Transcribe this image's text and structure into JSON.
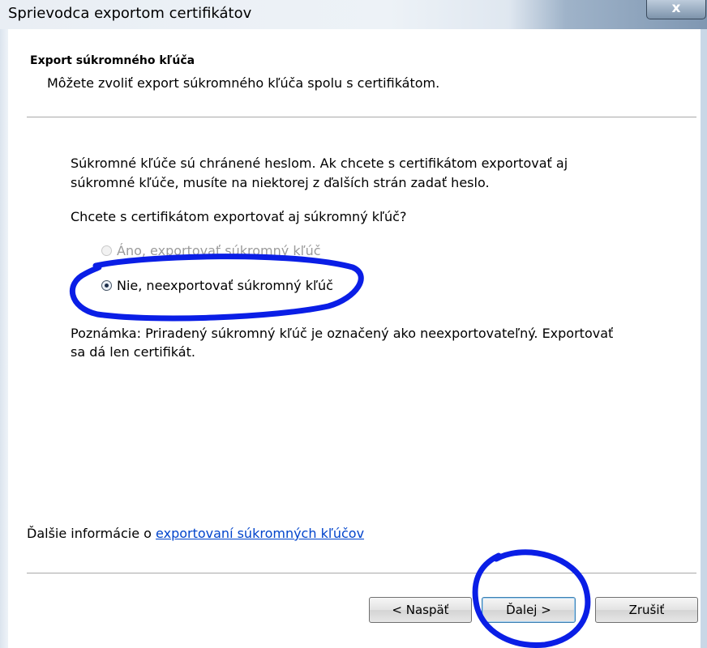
{
  "window": {
    "title": "Sprievodca exportom certifikátov",
    "close_label": "x"
  },
  "header": {
    "title": "Export súkromného kľúča",
    "subtitle": "Môžete zvoliť export súkromného kľúča spolu s certifikátom."
  },
  "body": {
    "info_line1": "Súkromné kľúče sú chránené heslom. Ak chcete s certifikátom exportovať aj",
    "info_line2": "súkromné kľúče, musíte na niektorej z ďalších strán zadať heslo.",
    "question": "Chcete s certifikátom exportovať aj súkromný kľúč?",
    "options": [
      {
        "label": "Áno, exportovať súkromný kľúč",
        "enabled": false,
        "selected": false
      },
      {
        "label": "Nie, neexportovať súkromný kľúč",
        "enabled": true,
        "selected": true
      }
    ],
    "note_line1": "Poznámka: Priradený súkromný kľúč je označený ako neexportovateľný. Exportovať",
    "note_line2": "sa dá len certifikát."
  },
  "footer": {
    "more_info_prefix": "Ďalšie informácie o ",
    "more_info_link": "exportovaní súkromných kľúčov"
  },
  "buttons": {
    "back": "< Naspäť",
    "next": "Ďalej >",
    "cancel": "Zrušiť"
  },
  "colors": {
    "annotation": "#0a1ee6",
    "link": "#0044cc"
  }
}
